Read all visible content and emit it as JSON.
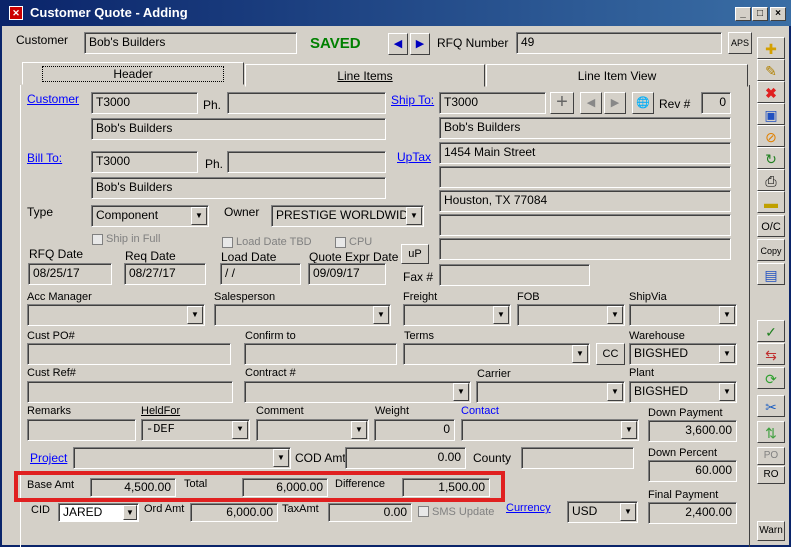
{
  "window": {
    "title": "Customer Quote - Adding",
    "min": "_",
    "max": "□",
    "close": "×"
  },
  "top": {
    "customer_label": "Customer",
    "customer_value": "Bob's Builders",
    "status": "SAVED",
    "rfq_label": "RFQ Number",
    "rfq_value": "49",
    "aps": "APS"
  },
  "tabs": [
    "Header",
    "Line Items",
    "Line Item View"
  ],
  "customer": {
    "label": "Customer",
    "code": "T3000",
    "ph_label": "Ph.",
    "ph": "",
    "name": "Bob's Builders"
  },
  "billto": {
    "label": "Bill To:",
    "code": "T3000",
    "ph_label": "Ph.",
    "ph": "",
    "name": "Bob's Builders"
  },
  "shipto": {
    "label": "Ship To:",
    "code": "T3000",
    "rev_label": "Rev #",
    "rev": "0",
    "name": "Bob's Builders",
    "uptax": "UpTax",
    "addr1": "1454 Main Street",
    "addr2": "",
    "city": "Houston, TX 77084",
    "addr4": "",
    "addr5": ""
  },
  "type": {
    "label": "Type",
    "value": "Component",
    "owner_label": "Owner",
    "owner_value": "PRESTIGE WORLDWID"
  },
  "checks": {
    "ship_in_full": "Ship in Full",
    "load_date_tbd": "Load Date TBD",
    "cpu": "CPU"
  },
  "dates": {
    "rfq_label": "RFQ Date",
    "rfq": "08/25/17",
    "req_label": "Req Date",
    "req": "08/27/17",
    "load_label": "Load Date",
    "load": " / /",
    "expr_label": "Quote Expr Date",
    "expr": "09/09/17",
    "up": "uP",
    "fax_label": "Fax #",
    "fax": ""
  },
  "row1": {
    "acc_manager": "Acc Manager",
    "salesperson": "Salesperson",
    "freight": "Freight",
    "fob": "FOB",
    "shipvia": "ShipVia"
  },
  "row2": {
    "cust_po": "Cust PO#",
    "confirm_to": "Confirm to",
    "terms": "Terms",
    "cc": "CC",
    "warehouse_label": "Warehouse",
    "warehouse": "BIGSHED"
  },
  "row3": {
    "cust_ref": "Cust Ref#",
    "contract": "Contract #",
    "carrier": "Carrier",
    "plant_label": "Plant",
    "plant": "BIGSHED"
  },
  "row4": {
    "remarks": "Remarks",
    "heldfor_label": "HeldFor",
    "heldfor": "-DEF",
    "comment": "Comment",
    "weight_label": "Weight",
    "weight": "0",
    "contact": "Contact",
    "down_payment_label": "Down Payment",
    "down_payment": "3,600.00"
  },
  "row5": {
    "project": "Project",
    "cod_label": "COD Amt",
    "cod": "0.00",
    "county_label": "County",
    "county": "",
    "down_percent_label": "Down Percent",
    "down_percent": "60.000"
  },
  "totals": {
    "base_label": "Base Amt",
    "base": "4,500.00",
    "total_label": "Total",
    "total": "6,000.00",
    "diff_label": "Difference",
    "diff": "1,500.00",
    "highlight": "#e02020"
  },
  "bottom": {
    "cid_label": "CID",
    "cid": "JARED",
    "ord_label": "Ord Amt",
    "ord": "6,000.00",
    "tax_label": "TaxAmt",
    "tax": "0.00",
    "sms": "SMS Update",
    "currency_label": "Currency",
    "currency": "USD",
    "final_label": "Final Payment",
    "final": "2,400.00"
  },
  "toolbar": {
    "oc": "O/C",
    "copy": "Copy",
    "po": "PO",
    "ro": "RO",
    "warn": "Warn"
  }
}
